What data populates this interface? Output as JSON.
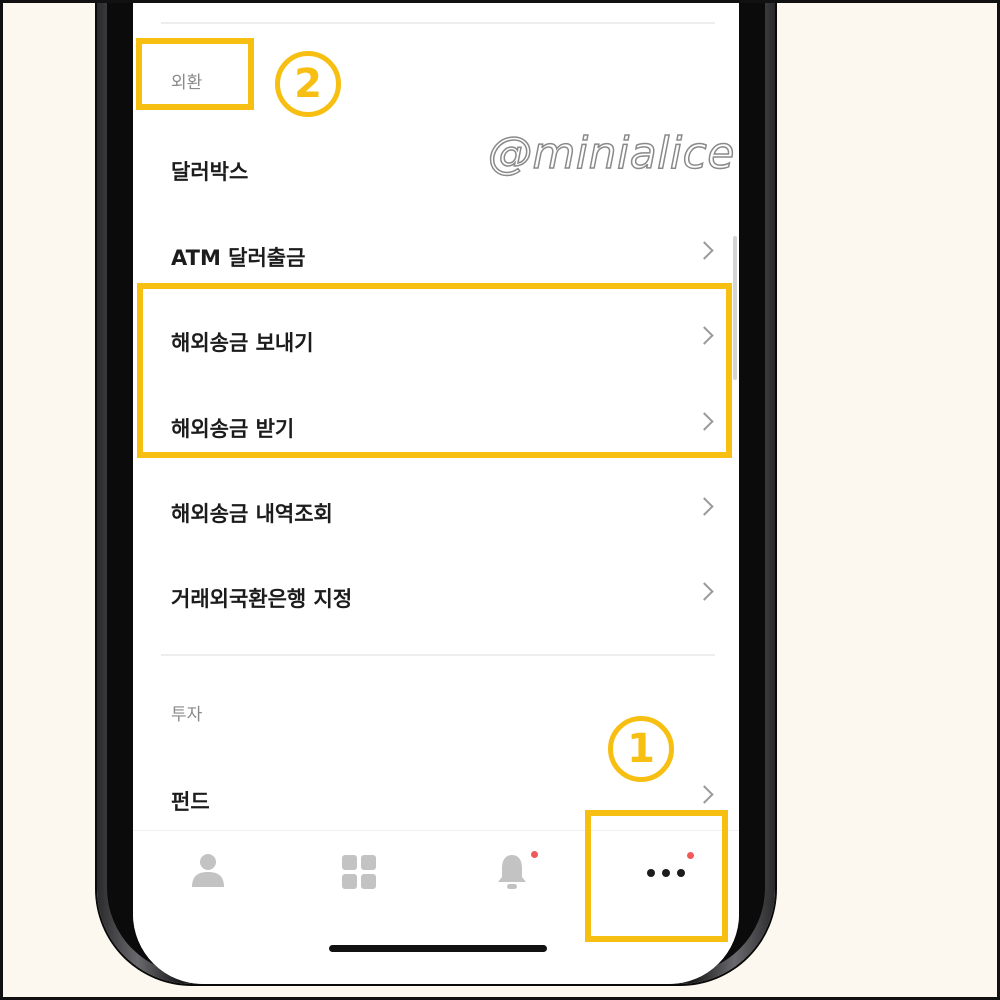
{
  "sections": {
    "forex_label": "외환",
    "invest_label": "투자"
  },
  "menu": {
    "dollar_box": "달러박스",
    "atm_dollar": "ATM 달러출금",
    "send_remit": "해외송금 보내기",
    "receive_remit": "해외송금 받기",
    "remit_history": "해외송금 내역조회",
    "designate_bank": "거래외국환은행 지정",
    "fund": "펀드"
  },
  "watermark": "@minialice",
  "annotations": {
    "step1": "1",
    "step2": "2",
    "color": "#f7bf11"
  },
  "tabbar": {
    "tabs": [
      "person-icon",
      "grid-icon",
      "bell-icon",
      "more-icon"
    ],
    "badge_color": "#f05a5a"
  }
}
